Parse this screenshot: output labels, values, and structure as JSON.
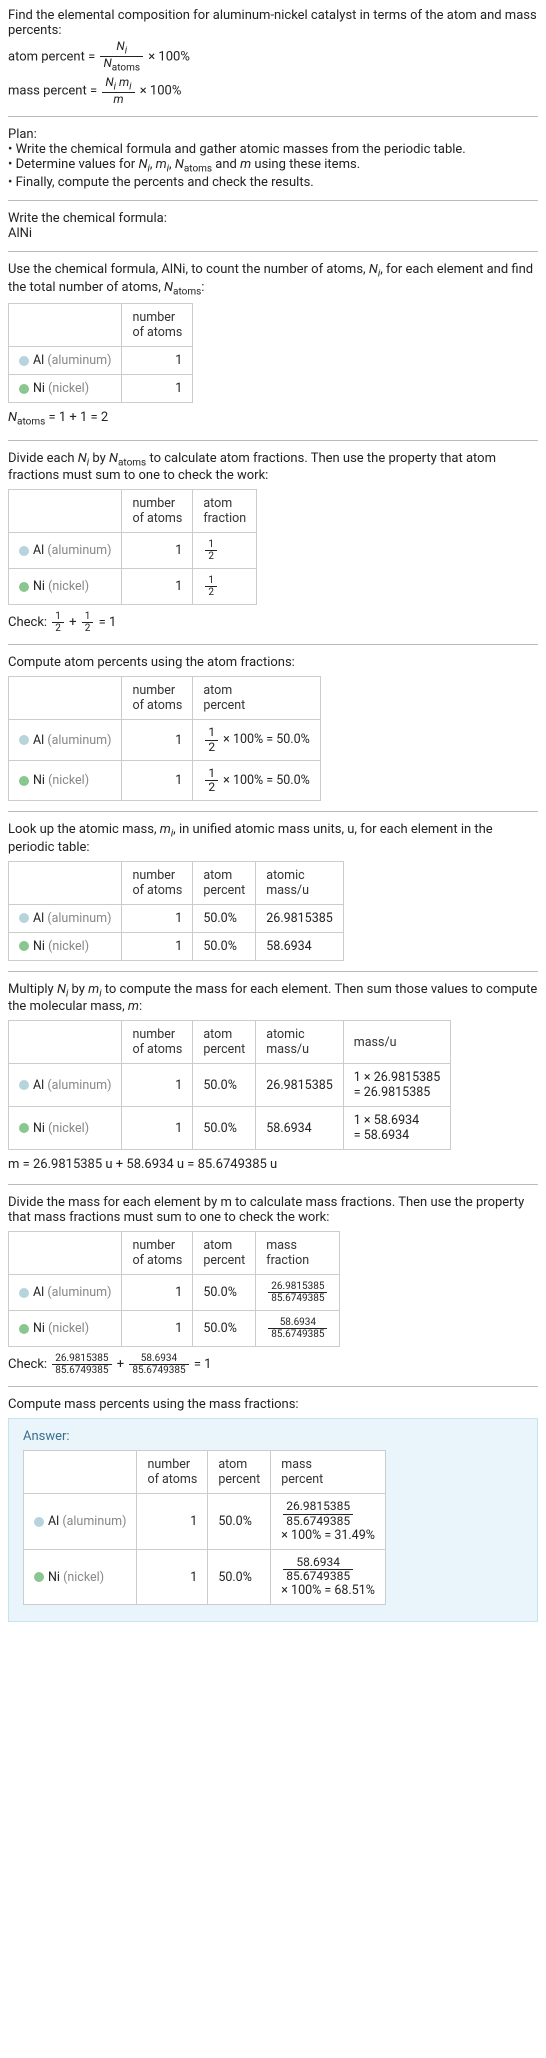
{
  "intro": {
    "line1": "Find the elemental composition for aluminum-nickel catalyst in terms of the atom and mass percents:",
    "atom_percent_lhs": "atom percent =",
    "atom_percent_num": "N_i",
    "atom_percent_den": "N_atoms",
    "times100": "× 100%",
    "mass_percent_lhs": "mass percent =",
    "mass_percent_num": "N_i m_i",
    "mass_percent_den": "m"
  },
  "plan": {
    "title": "Plan:",
    "b1": "• Write the chemical formula and gather atomic masses from the periodic table.",
    "b2_a": "• Determine values for ",
    "b2_b": " using these items.",
    "b3": "• Finally, compute the percents and check the results."
  },
  "chem": {
    "title": "Write the chemical formula:",
    "formula": "AlNi"
  },
  "count_atoms": {
    "desc_a": "Use the chemical formula, AlNi, to count the number of atoms, ",
    "desc_b": ", for each element and find the total number of atoms, ",
    "desc_c": ":",
    "col_atoms": "number\nof atoms",
    "row_al_name": "Al",
    "row_al_sub": "(aluminum)",
    "row_al_n": "1",
    "row_ni_name": "Ni",
    "row_ni_sub": "(nickel)",
    "row_ni_n": "1",
    "sum": " = 1 + 1 = 2"
  },
  "atom_fractions": {
    "desc_a": "Divide each ",
    "desc_b": " by ",
    "desc_c": " to calculate atom fractions. Then use the property that atom fractions must sum to one to check the work:",
    "col_frac": "atom\nfraction",
    "half_num": "1",
    "half_den": "2",
    "check": "Check: ",
    "check_eq": " = 1"
  },
  "atom_percents": {
    "desc": "Compute atom percents using the atom fractions:",
    "col_pct": "atom\npercent",
    "val": " × 100% = 50.0%"
  },
  "atomic_mass": {
    "desc_a": "Look up the atomic mass, ",
    "desc_b": ", in unified atomic mass units, u, for each element in the periodic table:",
    "col_mass": "atomic\nmass/u",
    "al_pct": "50.0%",
    "ni_pct": "50.0%",
    "al_mass": "26.9815385",
    "ni_mass": "58.6934"
  },
  "mass_calc": {
    "desc_a": "Multiply ",
    "desc_b": " by ",
    "desc_c": " to compute the mass for each element. Then sum those values to compute the molecular mass, ",
    "desc_d": ":",
    "col_massu": "mass/u",
    "al_calc": "1 × 26.9815385\n= 26.9815385",
    "ni_calc": "1 × 58.6934\n= 58.6934",
    "sum": "m = 26.9815385 u + 58.6934 u = 85.6749385 u"
  },
  "mass_fractions": {
    "desc": "Divide the mass for each element by m to calculate mass fractions. Then use the property that mass fractions must sum to one to check the work:",
    "col_frac": "mass\nfraction",
    "al_num": "26.9815385",
    "al_den": "85.6749385",
    "ni_num": "58.6934",
    "ni_den": "85.6749385",
    "check": "Check: ",
    "check_plus": " + ",
    "check_eq": " = 1"
  },
  "final": {
    "desc": "Compute mass percents using the mass fractions:",
    "answer_label": "Answer:",
    "col_masspct": "mass\npercent",
    "al_num": "26.9815385",
    "al_den": "85.6749385",
    "al_res": "× 100% = 31.49%",
    "ni_num": "58.6934",
    "ni_den": "85.6749385",
    "ni_res": "× 100% = 68.51%"
  },
  "chart_data": null
}
